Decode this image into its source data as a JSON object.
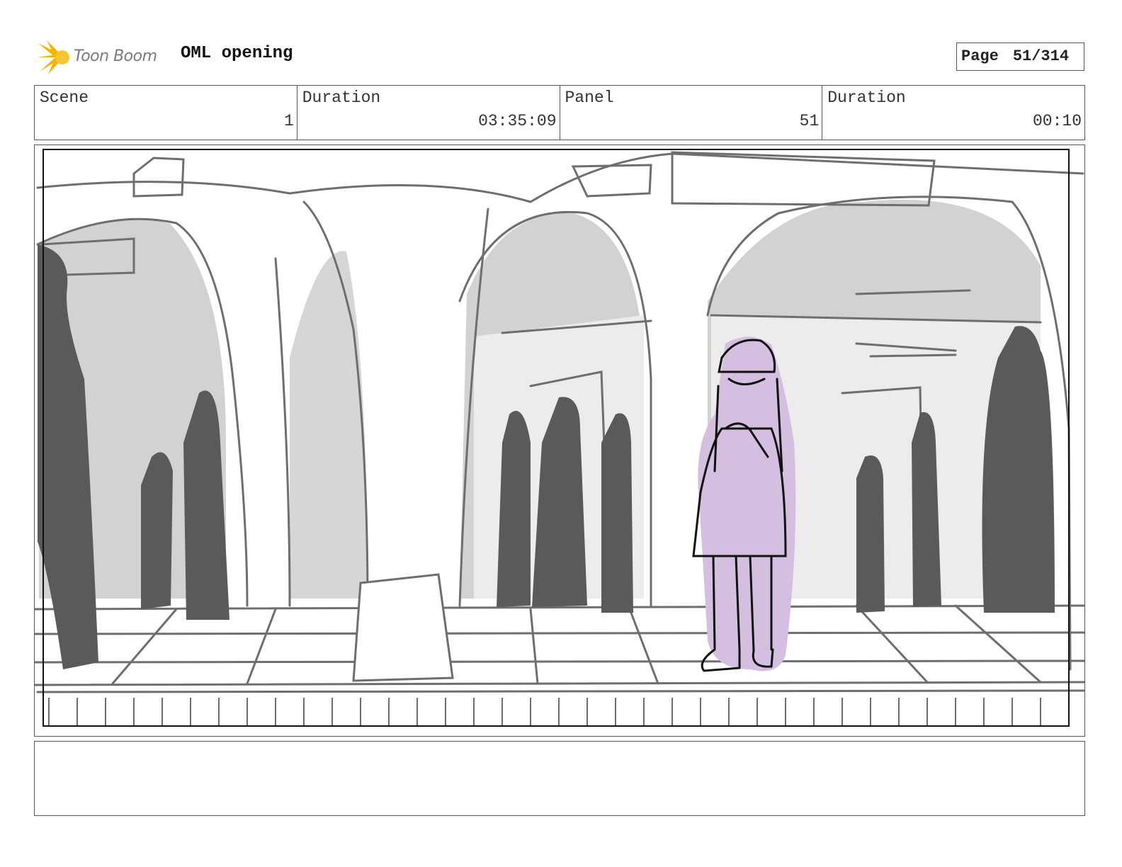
{
  "header": {
    "logo_text": "Toon Boom",
    "project_title": "OML opening",
    "page_label": "Page",
    "page_number": "51/314"
  },
  "info": {
    "scene_label": "Scene",
    "scene_value": "1",
    "scene_duration_label": "Duration",
    "scene_duration_value": "03:35:09",
    "panel_label": "Panel",
    "panel_value": "51",
    "panel_duration_label": "Duration",
    "panel_duration_value": "00:10"
  },
  "colors": {
    "sketch_line": "#6e6e6e",
    "fill_light": "#d2d2d2",
    "silhouette": "#5a5a5a",
    "character_fill": "#d5bfe0",
    "logo_accent": "#f4b400"
  },
  "notes": ""
}
